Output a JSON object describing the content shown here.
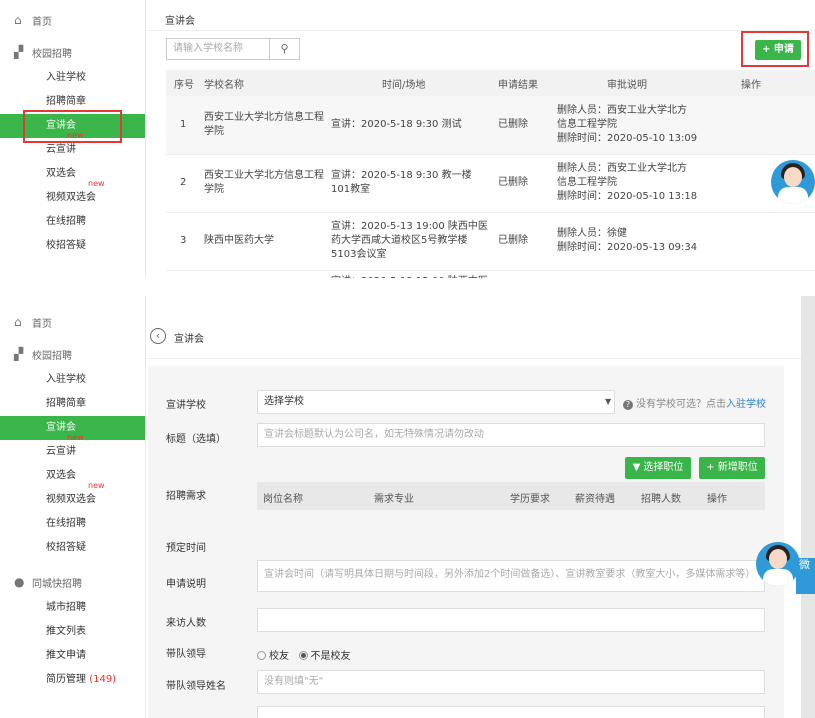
{
  "sidebar": {
    "home": "首页",
    "group_campus": "校园招聘",
    "campus_items": [
      "入驻学校",
      "招聘简章",
      "宣讲会",
      "云宣讲",
      "双选会",
      "视频双选会",
      "在线招聘",
      "校招答疑"
    ],
    "new_badge": "new",
    "group_city": "同城快招聘",
    "city_items": [
      "城市招聘",
      "推文列表",
      "推文申请"
    ],
    "resume_label": "简历管理",
    "resume_count": "(149)"
  },
  "list_page": {
    "title": "宣讲会",
    "search_placeholder": "请输入学校名称",
    "apply_button": "+ 申请",
    "headers": [
      "序号",
      "学校名称",
      "时间/场地",
      "申请结果",
      "审批说明",
      "操作"
    ],
    "rows": [
      {
        "no": "1",
        "school": "西安工业大学北方信息工程学院",
        "time_place": "宣讲：2020-5-18 9:30 测试",
        "result": "已删除",
        "note": [
          "删除人员：西安工业大学北方",
          "信息工程学院",
          "删除时间：2020-05-10 13:09"
        ]
      },
      {
        "no": "2",
        "school": "西安工业大学北方信息工程学院",
        "time_place": "宣讲：2020-5-18 9:30 教一楼101教室",
        "result": "已删除",
        "note": [
          "删除人员：西安工业大学北方",
          "信息工程学院",
          "删除时间：2020-05-10 13:18"
        ]
      },
      {
        "no": "3",
        "school": "陕西中医药大学",
        "time_place": "宣讲：2020-5-13 19:00 陕西中医药大学西咸大道校区5号教学楼5103会议室",
        "result": "已删除",
        "note": [
          "删除人员：徐健",
          "删除时间：2020-05-13 09:34"
        ]
      }
    ],
    "partial_row_text": "宣讲：2020-5-13 15:00 陕西中医"
  },
  "form_page": {
    "back_label": "宣讲会",
    "school_label": "宣讲学校",
    "school_select": "选择学校",
    "school_hint_prefix": "没有学校可选？点击",
    "school_hint_link": "入驻学校",
    "title_label": "标题（选填）",
    "title_placeholder": "宣讲会标题默认为公司名，如无特殊情况请勿改动",
    "select_position_btn": "▼ 选择职位",
    "add_position_btn": "+ 新增职位",
    "need_label": "招聘需求",
    "need_headers": [
      "岗位名称",
      "需求专业",
      "学历要求",
      "薪资待遇",
      "招聘人数",
      "操作"
    ],
    "schedule_label": "预定时间",
    "desc_label": "申请说明",
    "desc_placeholder": "宣讲会时间（请写明具体日期与时间段，另外添加2个时间做备选）、宣讲教室要求（教室大小，多媒体需求等）",
    "visitors_label": "来访人数",
    "leader_label": "带队领导",
    "leader_options": [
      "校友",
      "不是校友"
    ],
    "leader_name_label": "带队领导姓名",
    "leader_name_placeholder": "没有则填\"无\"",
    "side_tab_text": "微"
  }
}
